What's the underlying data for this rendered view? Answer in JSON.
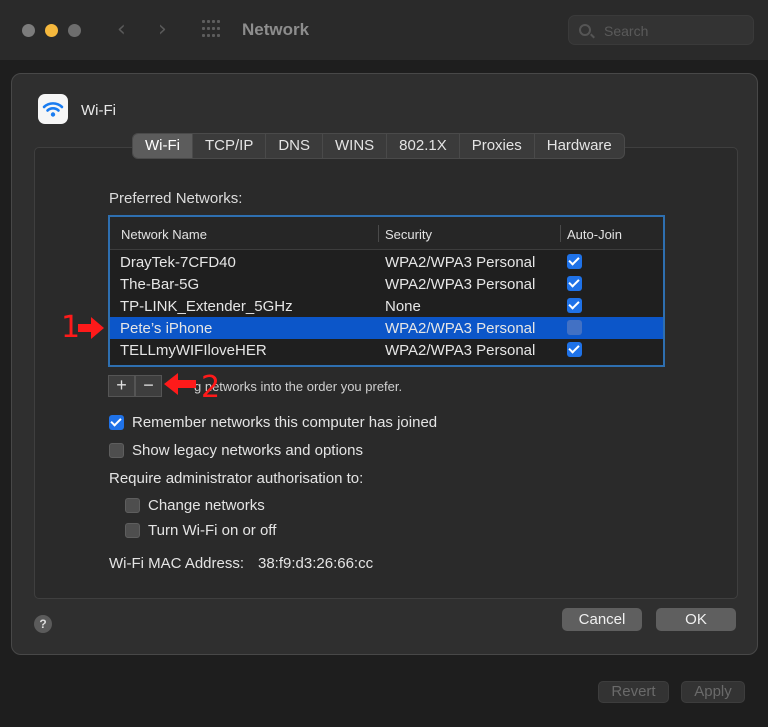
{
  "window": {
    "title": "Network",
    "search_placeholder": "Search"
  },
  "sheet": {
    "title": "Wi-Fi",
    "tabs": [
      {
        "label": "Wi-Fi",
        "active": true
      },
      {
        "label": "TCP/IP"
      },
      {
        "label": "DNS"
      },
      {
        "label": "WINS"
      },
      {
        "label": "802.1X"
      },
      {
        "label": "Proxies"
      },
      {
        "label": "Hardware"
      }
    ],
    "preferred_label": "Preferred Networks:",
    "columns": [
      "Network Name",
      "Security",
      "Auto-Join"
    ],
    "networks": [
      {
        "name": "DrayTek-7CFD40",
        "security": "WPA2/WPA3 Personal",
        "auto_join": true
      },
      {
        "name": "The-Bar-5G",
        "security": "WPA2/WPA3 Personal",
        "auto_join": true
      },
      {
        "name": "TP-LINK_Extender_5GHz",
        "security": "None",
        "auto_join": true
      },
      {
        "name": "Pete’s iPhone",
        "security": "WPA2/WPA3 Personal",
        "auto_join": false,
        "selected": true
      },
      {
        "name": "TELLmyWIFIloveHER",
        "security": "WPA2/WPA3 Personal",
        "auto_join": true
      }
    ],
    "add_label": "+",
    "remove_label": "−",
    "drag_hint": "g networks into the order you prefer.",
    "remember": {
      "label": "Remember networks this computer has joined",
      "checked": true
    },
    "legacy": {
      "label": "Show legacy networks and options",
      "checked": false
    },
    "require_label": "Require administrator authorisation to:",
    "change_networks": {
      "label": "Change networks",
      "checked": false
    },
    "turn_wifi": {
      "label": "Turn Wi-Fi on or off",
      "checked": false
    },
    "mac_label": "Wi-Fi MAC Address:",
    "mac_value": "38:f9:d3:26:66:cc",
    "help_label": "?",
    "cancel_label": "Cancel",
    "ok_label": "OK"
  },
  "footer": {
    "revert_label": "Revert",
    "apply_label": "Apply"
  },
  "annotations": {
    "marker_1": "1",
    "marker_2": "2",
    "color": "#ff1a1a"
  },
  "colors": {
    "accent": "#1f72e8",
    "selection": "#0c56c9",
    "table_border": "#2e6fb0"
  }
}
